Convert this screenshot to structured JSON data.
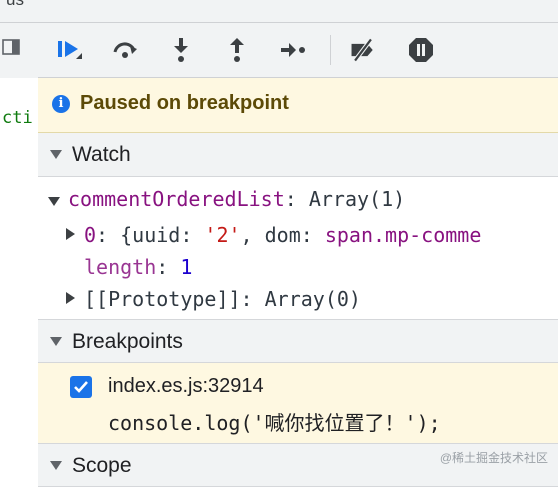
{
  "left_pane": {
    "top_text": "us",
    "code_fragment": "cti"
  },
  "toolbar": {
    "buttons": [
      {
        "name": "resume-icon"
      },
      {
        "name": "step-over-icon"
      },
      {
        "name": "step-into-icon"
      },
      {
        "name": "step-out-icon"
      },
      {
        "name": "step-icon"
      },
      {
        "name": "deactivate-breakpoints-icon"
      },
      {
        "name": "pause-on-exceptions-icon"
      }
    ]
  },
  "paused": {
    "icon": "info-icon",
    "text": "Paused on breakpoint"
  },
  "watch": {
    "title": "Watch",
    "expression_name": "commentOrderedList",
    "expression_colon": ":",
    "expression_value": "Array(1)",
    "item0_key": "0",
    "item0_prefix": ": {uuid: ",
    "item0_uuid": "'2'",
    "item0_mid": ", dom: ",
    "item0_dom": "span.mp-comme",
    "length_key": "length",
    "length_colon": ":",
    "length_value": "1",
    "proto_key": "[[Prototype]]",
    "proto_colon": ":",
    "proto_value": "Array(0)"
  },
  "breakpoints": {
    "title": "Breakpoints",
    "items": [
      {
        "checked": true,
        "location": "index.es.js:32914",
        "code": "console.log('喊你找位置了！');"
      }
    ]
  },
  "scope": {
    "title": "Scope"
  },
  "watermark": "@稀土掘金技术社区",
  "colors": {
    "accent": "#1a73e8",
    "paused_bg": "#fef8e1",
    "toolbar_bg": "#f1f3f4"
  }
}
